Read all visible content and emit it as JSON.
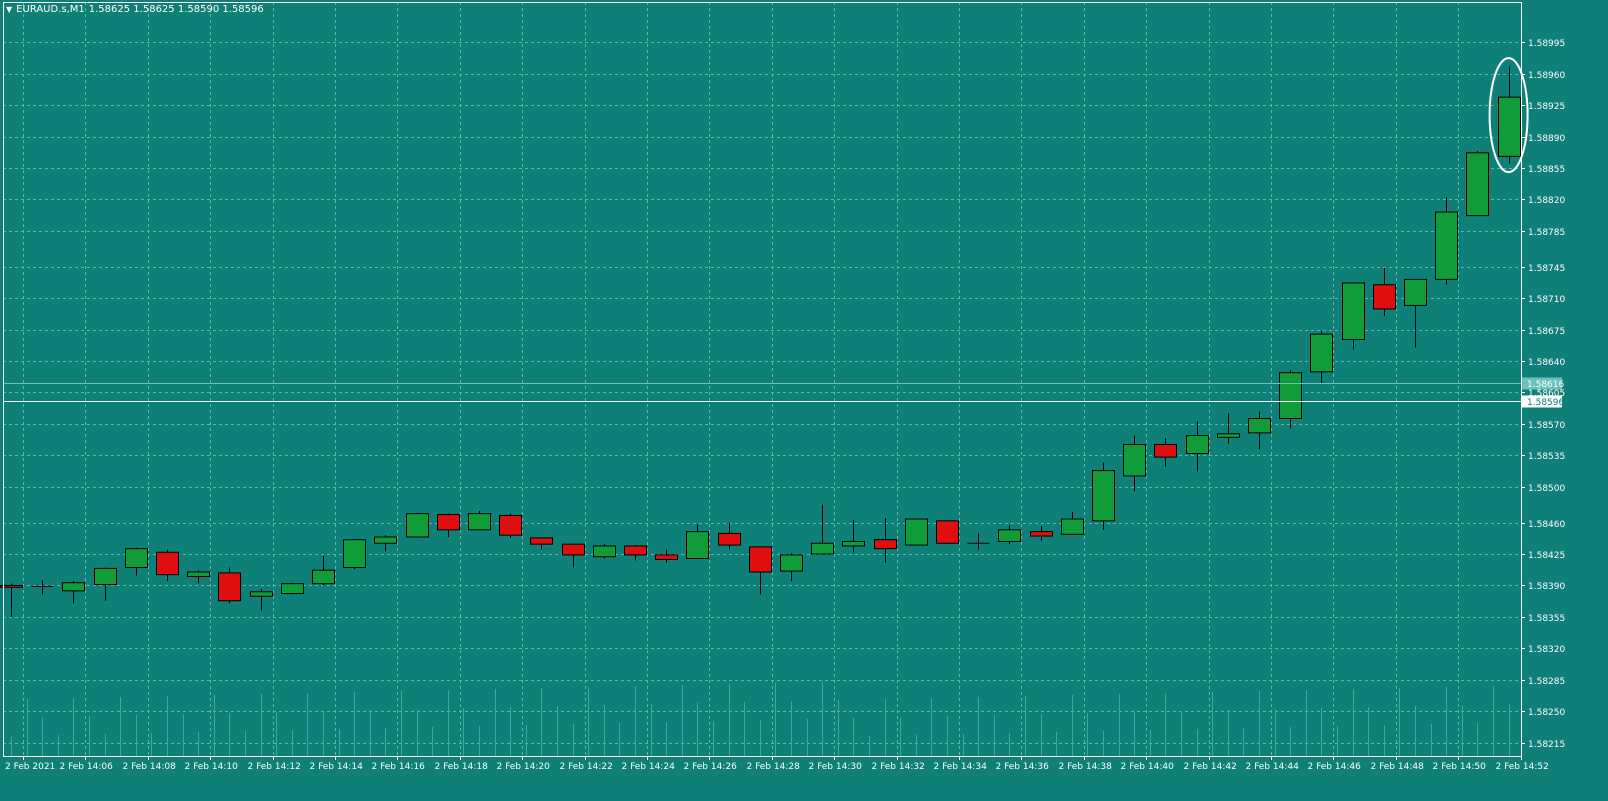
{
  "window": {
    "symbol": "EURAUD.s,M1",
    "ohlc": "1.58625 1.58625 1.58590 1.58596",
    "menu_icon": "triangle-down-icon"
  },
  "colors": {
    "background": "#0e8078",
    "grid": "#5fb5ad",
    "axis": "#ffffff",
    "bull": "#119c3a",
    "bear": "#e00f0f",
    "outline": "#000000",
    "volume": "#3aa9a0",
    "bid_line": "#ffffff",
    "ask_line": "#6cc2bb",
    "annotation": "#ffffff"
  },
  "price_labels": {
    "ask": "1.58616",
    "bid": "1.58596"
  },
  "chart_data": {
    "type": "candlestick",
    "ylim": [
      1.582,
      1.5904
    ],
    "y_ticks": [
      "1.58995",
      "1.58960",
      "1.58925",
      "1.58890",
      "1.58855",
      "1.58820",
      "1.58785",
      "1.58745",
      "1.58710",
      "1.58675",
      "1.58640",
      "1.58605",
      "1.58570",
      "1.58535",
      "1.58500",
      "1.58460",
      "1.58425",
      "1.58390",
      "1.58355",
      "1.58320",
      "1.58285",
      "1.58250",
      "1.58215"
    ],
    "x_ticks": [
      "2 Feb 2021",
      "2 Feb 14:06",
      "2 Feb 14:08",
      "2 Feb 14:10",
      "2 Feb 14:12",
      "2 Feb 14:14",
      "2 Feb 14:16",
      "2 Feb 14:18",
      "2 Feb 14:20",
      "2 Feb 14:22",
      "2 Feb 14:24",
      "2 Feb 14:26",
      "2 Feb 14:28",
      "2 Feb 14:30",
      "2 Feb 14:32",
      "2 Feb 14:34",
      "2 Feb 14:36",
      "2 Feb 14:38",
      "2 Feb 14:40",
      "2 Feb 14:42",
      "2 Feb 14:44",
      "2 Feb 14:46",
      "2 Feb 14:48",
      "2 Feb 14:50",
      "2 Feb 14:52"
    ],
    "bid": 1.58596,
    "ask": 1.58616,
    "candles": [
      {
        "o": 1.5839,
        "h": 1.58392,
        "l": 1.58355,
        "c": 1.58388
      },
      {
        "o": 1.58388,
        "h": 1.58396,
        "l": 1.5838,
        "c": 1.58389
      },
      {
        "o": 1.58384,
        "h": 1.58395,
        "l": 1.5837,
        "c": 1.58393
      },
      {
        "o": 1.58391,
        "h": 1.5841,
        "l": 1.58373,
        "c": 1.58409
      },
      {
        "o": 1.5841,
        "h": 1.58432,
        "l": 1.58401,
        "c": 1.58431
      },
      {
        "o": 1.58427,
        "h": 1.5843,
        "l": 1.58395,
        "c": 1.58402
      },
      {
        "o": 1.584,
        "h": 1.58407,
        "l": 1.58392,
        "c": 1.58405
      },
      {
        "o": 1.58404,
        "h": 1.5841,
        "l": 1.5837,
        "c": 1.58373
      },
      {
        "o": 1.58378,
        "h": 1.58386,
        "l": 1.58362,
        "c": 1.58383
      },
      {
        "o": 1.58381,
        "h": 1.58393,
        "l": 1.5838,
        "c": 1.58392
      },
      {
        "o": 1.58392,
        "h": 1.58423,
        "l": 1.5839,
        "c": 1.58407
      },
      {
        "o": 1.5841,
        "h": 1.58442,
        "l": 1.58408,
        "c": 1.58441
      },
      {
        "o": 1.58437,
        "h": 1.58446,
        "l": 1.58428,
        "c": 1.58444
      },
      {
        "o": 1.58444,
        "h": 1.58471,
        "l": 1.58443,
        "c": 1.5847
      },
      {
        "o": 1.58469,
        "h": 1.5847,
        "l": 1.58444,
        "c": 1.58452
      },
      {
        "o": 1.58452,
        "h": 1.58473,
        "l": 1.58452,
        "c": 1.5847
      },
      {
        "o": 1.58468,
        "h": 1.5847,
        "l": 1.58443,
        "c": 1.58446
      },
      {
        "o": 1.58443,
        "h": 1.58443,
        "l": 1.5843,
        "c": 1.58436
      },
      {
        "o": 1.58436,
        "h": 1.58436,
        "l": 1.5841,
        "c": 1.58424
      },
      {
        "o": 1.58422,
        "h": 1.58436,
        "l": 1.5842,
        "c": 1.58434
      },
      {
        "o": 1.58434,
        "h": 1.58435,
        "l": 1.58418,
        "c": 1.58424
      },
      {
        "o": 1.58424,
        "h": 1.5843,
        "l": 1.58415,
        "c": 1.58419
      },
      {
        "o": 1.5842,
        "h": 1.58458,
        "l": 1.5842,
        "c": 1.5845
      },
      {
        "o": 1.58448,
        "h": 1.5846,
        "l": 1.5843,
        "c": 1.58435
      },
      {
        "o": 1.58433,
        "h": 1.58433,
        "l": 1.5838,
        "c": 1.58405
      },
      {
        "o": 1.58406,
        "h": 1.58426,
        "l": 1.58395,
        "c": 1.58424
      },
      {
        "o": 1.58425,
        "h": 1.5848,
        "l": 1.58424,
        "c": 1.58437
      },
      {
        "o": 1.58434,
        "h": 1.58463,
        "l": 1.58427,
        "c": 1.58439
      },
      {
        "o": 1.58441,
        "h": 1.58465,
        "l": 1.58415,
        "c": 1.58431
      },
      {
        "o": 1.58435,
        "h": 1.58464,
        "l": 1.58435,
        "c": 1.58464
      },
      {
        "o": 1.58462,
        "h": 1.58462,
        "l": 1.58436,
        "c": 1.58437
      },
      {
        "o": 1.58437,
        "h": 1.58448,
        "l": 1.5843,
        "c": 1.58437
      },
      {
        "o": 1.58439,
        "h": 1.58457,
        "l": 1.58436,
        "c": 1.58452
      },
      {
        "o": 1.5845,
        "h": 1.58456,
        "l": 1.5844,
        "c": 1.58445
      },
      {
        "o": 1.58447,
        "h": 1.58472,
        "l": 1.58447,
        "c": 1.58464
      },
      {
        "o": 1.58462,
        "h": 1.58527,
        "l": 1.58452,
        "c": 1.58518
      },
      {
        "o": 1.58512,
        "h": 1.58557,
        "l": 1.58495,
        "c": 1.58547
      },
      {
        "o": 1.58547,
        "h": 1.58554,
        "l": 1.58522,
        "c": 1.58533
      },
      {
        "o": 1.58537,
        "h": 1.58573,
        "l": 1.58517,
        "c": 1.58557
      },
      {
        "o": 1.58555,
        "h": 1.58582,
        "l": 1.58548,
        "c": 1.58559
      },
      {
        "o": 1.5856,
        "h": 1.58584,
        "l": 1.58542,
        "c": 1.58576
      },
      {
        "o": 1.58576,
        "h": 1.5863,
        "l": 1.58565,
        "c": 1.58627
      },
      {
        "o": 1.58628,
        "h": 1.58673,
        "l": 1.58615,
        "c": 1.5867
      },
      {
        "o": 1.58664,
        "h": 1.58726,
        "l": 1.58653,
        "c": 1.58727
      },
      {
        "o": 1.58725,
        "h": 1.58744,
        "l": 1.5869,
        "c": 1.58698
      },
      {
        "o": 1.58702,
        "h": 1.58731,
        "l": 1.58655,
        "c": 1.58731
      },
      {
        "o": 1.58731,
        "h": 1.58822,
        "l": 1.58725,
        "c": 1.58806
      },
      {
        "o": 1.58802,
        "h": 1.58874,
        "l": 1.58802,
        "c": 1.58872
      },
      {
        "o": 1.58868,
        "h": 1.58968,
        "l": 1.5886,
        "c": 1.58934
      }
    ]
  }
}
